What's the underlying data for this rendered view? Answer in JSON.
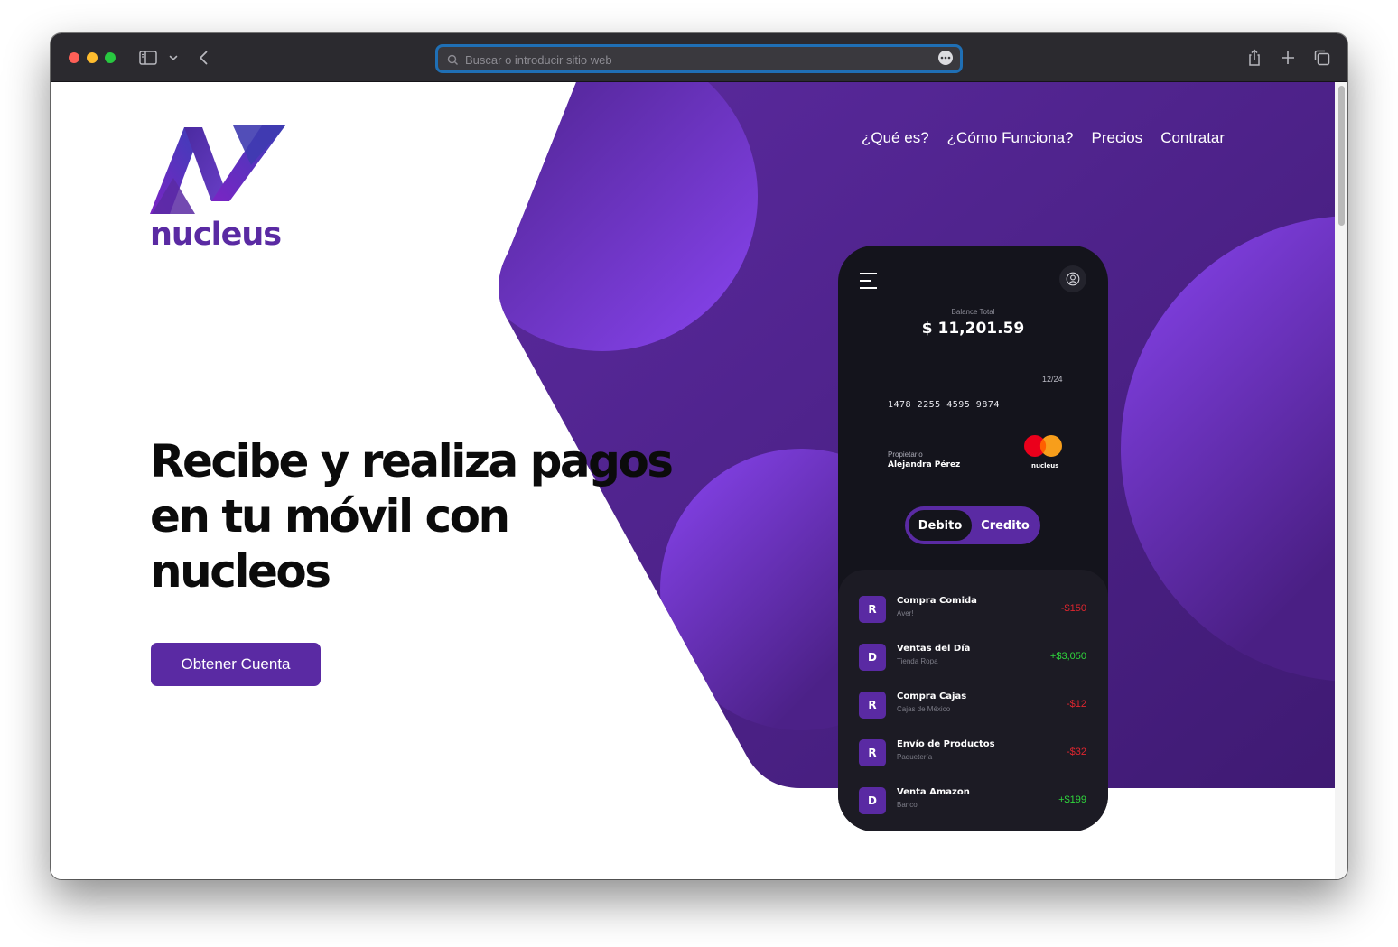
{
  "browser": {
    "address_placeholder": "Buscar o introducir sitio web"
  },
  "colors": {
    "brand_purple": "#5a2aa3",
    "hero_bg_purple": "#57289b",
    "phone_bg": "#14141c",
    "negative_amount": "#e0262f",
    "positive_amount": "#2fd63c"
  },
  "logo": {
    "wordmark": "nucleus"
  },
  "nav": {
    "items": [
      {
        "label": "¿Qué es?"
      },
      {
        "label": "¿Cómo Funciona?"
      },
      {
        "label": "Precios"
      },
      {
        "label": "Contratar"
      }
    ]
  },
  "hero": {
    "title_lines": [
      "Recibe y realiza pagos",
      "en tu móvil con",
      "nucleos"
    ],
    "cta_label": "Obtener Cuenta"
  },
  "phone": {
    "balance_label": "Balance Total",
    "balance_value": "$ 11,201.59",
    "card": {
      "expiry": "12/24",
      "number": "1478 2255 4595 9874",
      "owner_label": "Propietario",
      "owner_name": "Alejandra Pérez",
      "brand": "nucleus"
    },
    "toggle": {
      "active": "Debito",
      "inactive": "Credito"
    },
    "transactions": [
      {
        "badge": "R",
        "title": "Compra Comida",
        "subtitle": "Aver!",
        "amount": "-$150",
        "type": "negative"
      },
      {
        "badge": "D",
        "title": "Ventas del Día",
        "subtitle": "Tienda Ropa",
        "amount": "+$3,050",
        "type": "positive"
      },
      {
        "badge": "R",
        "title": "Compra Cajas",
        "subtitle": "Cajas de México",
        "amount": "-$12",
        "type": "negative"
      },
      {
        "badge": "R",
        "title": "Envío de Productos",
        "subtitle": "Paquetería",
        "amount": "-$32",
        "type": "negative"
      },
      {
        "badge": "D",
        "title": "Venta Amazon",
        "subtitle": "Banco",
        "amount": "+$199",
        "type": "positive"
      }
    ]
  }
}
